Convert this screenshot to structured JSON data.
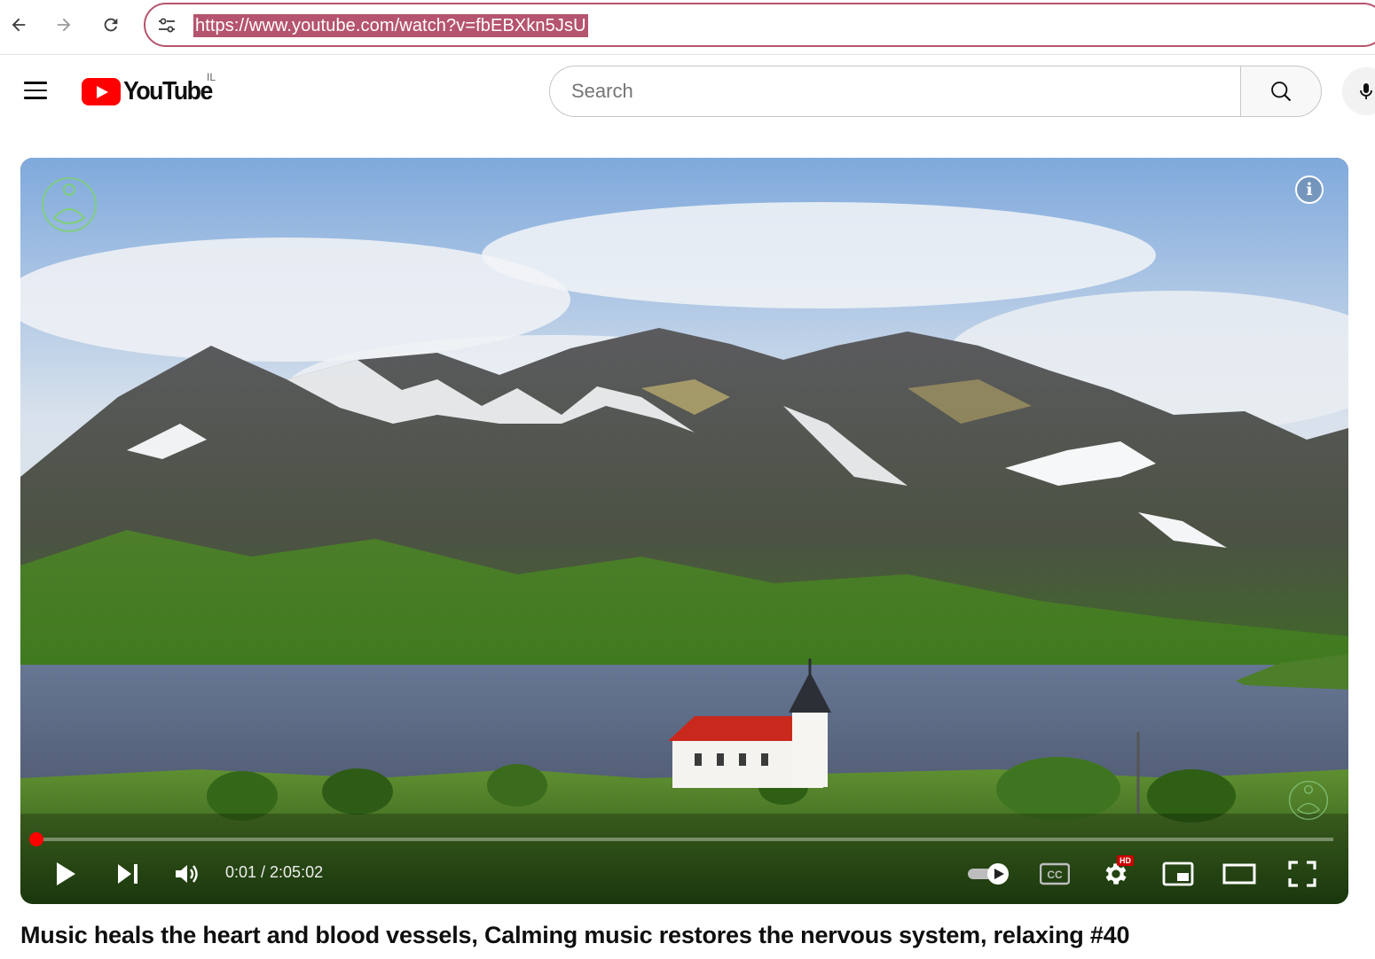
{
  "browser": {
    "url": "https://www.youtube.com/watch?v=fbEBXkn5JsU"
  },
  "header": {
    "logo_text": "YouTube",
    "country_code": "IL",
    "search_placeholder": "Search"
  },
  "player": {
    "current_time": "0:01",
    "duration": "2:05:02",
    "time_display": "0:01 / 2:05:02",
    "progress_fraction": 0.0001,
    "quality_badge": "HD",
    "info_glyph": "i",
    "icons": [
      "play-icon",
      "next-icon",
      "volume-icon",
      "autoplay-toggle-icon",
      "captions-icon",
      "settings-icon",
      "miniplayer-icon",
      "theater-icon",
      "fullscreen-icon"
    ]
  },
  "video": {
    "title": "Music heals the heart and blood vessels, Calming music restores the nervous system, relaxing #40"
  },
  "colors": {
    "brand_red": "#ff0000",
    "omnibox_highlight": "#b5546e"
  }
}
